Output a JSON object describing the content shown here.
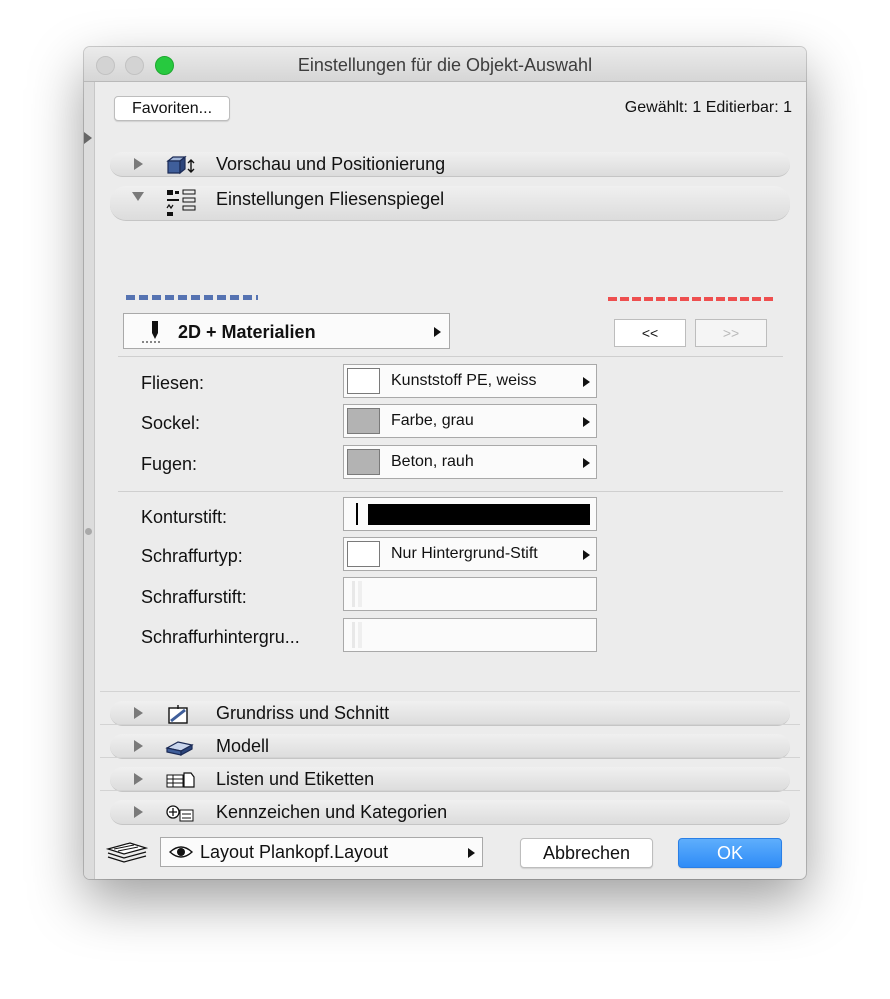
{
  "window": {
    "title": "Einstellungen für die Objekt-Auswahl"
  },
  "toolbar": {
    "favorites_label": "Favoriten...",
    "selection_count": "Gewählt: 1 Editierbar: 1"
  },
  "panels_top": [
    {
      "label": "Vorschau und Positionierung",
      "icon": "box-position-icon",
      "state": "collapsed"
    },
    {
      "label": "Einstellungen Fliesenspiegel",
      "icon": "settings-list-icon",
      "state": "expanded"
    }
  ],
  "subpanel": {
    "category_label": "2D + Materialien",
    "category_icon": "pen-icon",
    "prev_label": "<<",
    "next_label": ">>"
  },
  "materials": [
    {
      "label": "Fliesen:",
      "value": "Kunststoff PE, weiss",
      "swatch": "#ffffff"
    },
    {
      "label": "Sockel:",
      "value": "Farbe, grau",
      "swatch": "#b3b3b3"
    },
    {
      "label": "Fugen:",
      "value": "Beton, rauh",
      "swatch": "#b3b3b3"
    }
  ],
  "pens": {
    "contour_label": "Konturstift:",
    "hatch_type_label": "Schraffurtyp:",
    "hatch_type_value": "Nur Hintergrund-Stift",
    "hatch_pen_label": "Schraffurstift:",
    "hatch_bg_label": "Schraffurhintergru..."
  },
  "panels_bottom": [
    {
      "label": "Grundriss und Schnitt",
      "icon": "floorplan-section-icon"
    },
    {
      "label": "Modell",
      "icon": "model-icon"
    },
    {
      "label": "Listen und Etiketten",
      "icon": "list-label-icon"
    },
    {
      "label": "Kennzeichen und Kategorien",
      "icon": "tag-category-icon"
    }
  ],
  "footer": {
    "layout_label": "Layout Plankopf.Layout",
    "cancel_label": "Abbrechen",
    "ok_label": "OK"
  },
  "colors": {
    "accent": "#2f8cf7",
    "close_disabled": "#d3d3d3",
    "zoom": "#27c93f"
  }
}
